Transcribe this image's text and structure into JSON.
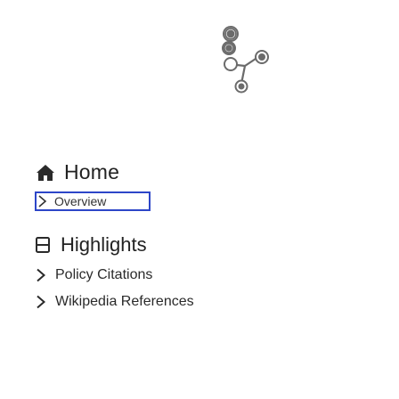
{
  "icons": {
    "logo": "molecule-logo",
    "home": "home-icon",
    "overview": "caret-right-icon",
    "highlights": "document-icon",
    "items": "chevron-right-icon"
  },
  "colors": {
    "logo_stroke": "#6b6b6b",
    "focus_border": "#2d46c8",
    "text": "#222222"
  },
  "nav": {
    "home_label": "Home",
    "overview_label": "Overview",
    "highlights_label": "Highlights",
    "items": [
      {
        "label": "Policy Citations"
      },
      {
        "label": "Wikipedia References"
      }
    ]
  }
}
